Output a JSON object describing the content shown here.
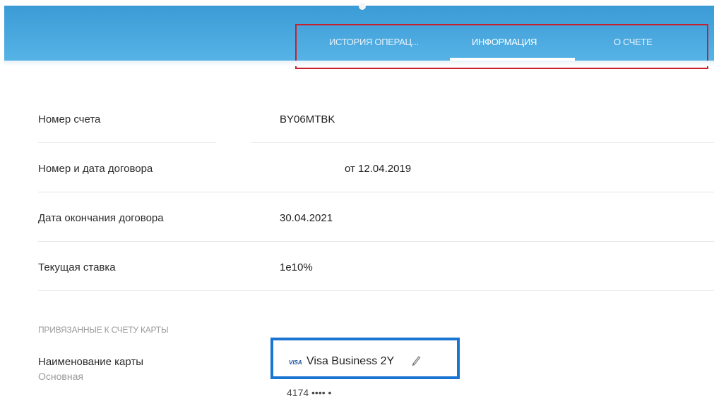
{
  "tabs": [
    {
      "label": "ИСТОРИЯ ОПЕРАЦ..."
    },
    {
      "label": "ИНФОРМАЦИЯ",
      "active": true
    },
    {
      "label": "О СЧЕТЕ"
    }
  ],
  "details": [
    {
      "label": "Номер счета",
      "value": "BY06MTBK"
    },
    {
      "label": "Номер и дата договора",
      "value": "от 12.04.2019"
    },
    {
      "label": "Дата окончания договора",
      "value": "30.04.2021"
    },
    {
      "label": "Текущая ставка",
      "value": "1е10%"
    }
  ],
  "cards_section": {
    "title": "ПРИВЯЗАННЫЕ К СЧЕТУ КАРТЫ",
    "card_label": "Наименование карты",
    "card_sublabel": "Основная",
    "card_brand": "VISA",
    "card_name": "Visa Business 2Y",
    "card_number": "4174 •••• •"
  },
  "colors": {
    "header": "#4aa8e0",
    "highlight_red": "#c8202a",
    "highlight_blue": "#1a75d2"
  }
}
